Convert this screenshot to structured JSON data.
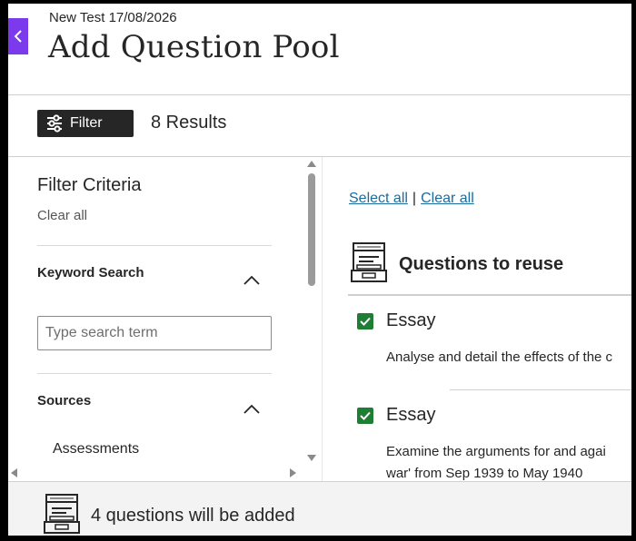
{
  "header": {
    "test_name": "New Test 17/08/2026",
    "title": "Add Question Pool"
  },
  "toolbar": {
    "filter_label": "Filter",
    "results": "8 Results"
  },
  "sidebar": {
    "title": "Filter Criteria",
    "clear_all": "Clear all",
    "keyword_search": {
      "title": "Keyword Search",
      "placeholder": "Type search term"
    },
    "sources": {
      "title": "Sources",
      "items": [
        "Assessments"
      ]
    }
  },
  "content": {
    "select_all": "Select all",
    "separator": "|",
    "clear_all": "Clear all",
    "pool_title": "Questions to reuse",
    "questions": [
      {
        "type": "Essay",
        "checked": true,
        "text_lines": [
          "Analyse and detail the effects of the c"
        ]
      },
      {
        "type": "Essay",
        "checked": true,
        "text_lines": [
          "Examine the arguments for and agai",
          "war' from Sep 1939 to May 1940"
        ]
      }
    ]
  },
  "footer": {
    "summary": "4 questions will be added"
  },
  "colors": {
    "accent_purple": "#7c3aed",
    "check_green": "#1e7e34",
    "link_blue": "#1b6c9e",
    "dark_button": "#262626"
  }
}
